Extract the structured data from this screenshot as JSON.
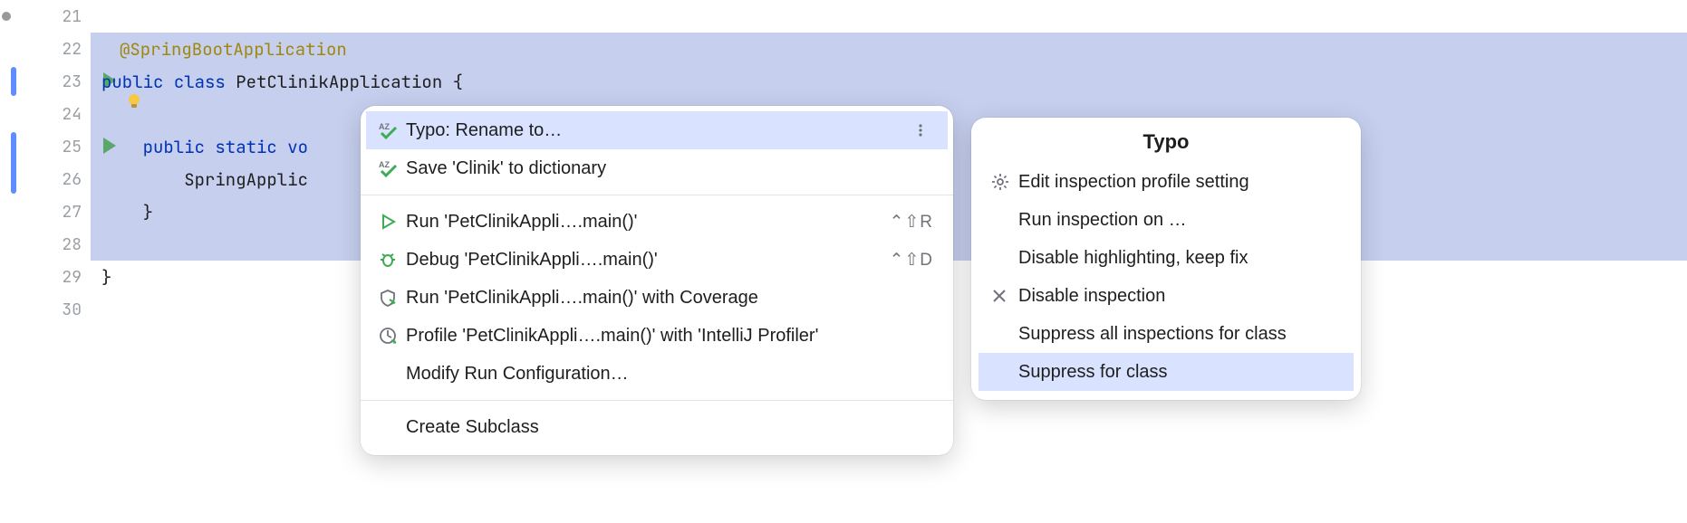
{
  "gutter": {
    "lines": [
      21,
      22,
      23,
      24,
      25,
      26,
      27,
      28,
      29,
      30
    ]
  },
  "code": {
    "l22_annot": "@SpringBootApplication",
    "l23_kw1": "public",
    "l23_kw2": "class",
    "l23_name": "PetClinikApplication",
    "l23_brace": " {",
    "l25_kw": "public static vo",
    "l26_text": "SpringApplic",
    "l27_brace": "}",
    "l29_brace": "}"
  },
  "popup1": {
    "items": [
      {
        "label": "Typo: Rename to…",
        "icon": "spell",
        "selected": true,
        "ellipsis": true
      },
      {
        "label": "Save 'Clinik' to dictionary",
        "icon": "spell"
      }
    ],
    "items2": [
      {
        "label": "Run 'PetClinikAppli….main()'",
        "icon": "run",
        "shortcut": "⌃⇧R"
      },
      {
        "label": "Debug 'PetClinikAppli….main()'",
        "icon": "debug",
        "shortcut": "⌃⇧D"
      },
      {
        "label": "Run 'PetClinikAppli….main()' with Coverage",
        "icon": "coverage"
      },
      {
        "label": "Profile 'PetClinikAppli….main()' with 'IntelliJ Profiler'",
        "icon": "profile"
      },
      {
        "label": "Modify Run Configuration…",
        "icon": ""
      }
    ],
    "items3": [
      {
        "label": "Create Subclass",
        "icon": ""
      }
    ]
  },
  "popup2": {
    "title": "Typo",
    "items": [
      {
        "label": "Edit inspection profile setting",
        "icon": "gear"
      },
      {
        "label": "Run inspection on …"
      },
      {
        "label": "Disable highlighting, keep fix"
      },
      {
        "label": "Disable inspection",
        "icon": "x"
      },
      {
        "label": "Suppress all inspections for class"
      },
      {
        "label": "Suppress for class",
        "selected": true
      }
    ]
  }
}
